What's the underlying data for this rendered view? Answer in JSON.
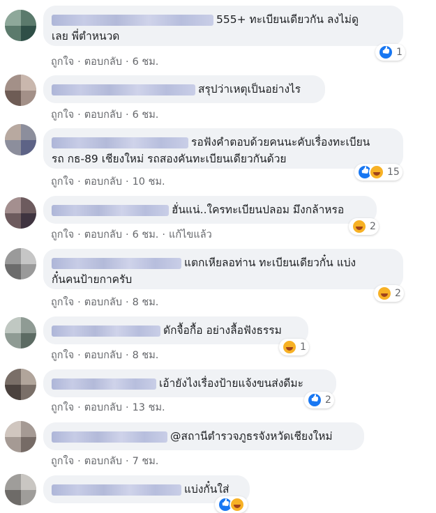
{
  "labels": {
    "like": "ถูกใจ",
    "reply": "ตอบกลับ",
    "dot": "·",
    "edited": "แก้ไขแล้ว"
  },
  "colors": {
    "bubble": "#f0f2f5",
    "meta": "#65676b",
    "like_blue": "#1877f2",
    "haha_yellow": "#f7b125"
  },
  "comments": [
    {
      "lines": [
        "555+ ทะเบียนเดียวกัน ลงไม่ดู",
        "เลย พี่ตำหนวด"
      ],
      "time": "6 ชม.",
      "reactions": [
        "like-icon"
      ],
      "count": "1"
    },
    {
      "lines": [
        "สรุปว่าเหตุเป็นอย่างไร"
      ],
      "time": "6 ชม.",
      "reactions": [],
      "count": ""
    },
    {
      "lines": [
        "รอฟังคำตอบด้วยคนนะคับเรื่องทะเบียน",
        "รถ กธ-89 เชียงใหม่ รถสองคันทะเบียนเดียวกันด้วย"
      ],
      "time": "10 ชม.",
      "reactions": [
        "like-icon",
        "haha-icon"
      ],
      "count": "15"
    },
    {
      "lines": [
        "ฮั่นแน่..ใครทะเบียนปลอม มึงกล้าหรอ"
      ],
      "time": "6 ชม.",
      "edited": true,
      "reactions": [
        "haha-icon"
      ],
      "count": "2"
    },
    {
      "lines": [
        "แตกเหียลอท่าน ทะเบียนเดียวกั๋น แบ่ง",
        "กั๋นคนป้ายกาครับ"
      ],
      "time": "8 ชม.",
      "reactions": [
        "haha-icon"
      ],
      "count": "2"
    },
    {
      "lines": [
        "ดักจื้อกื้อ อย่างลื้อฟังธรรม"
      ],
      "time": "8 ชม.",
      "reactions": [
        "haha-icon"
      ],
      "count": "1"
    },
    {
      "lines": [
        "เอ้ายังไงเรื่องป้ายแจ้งขนส่งดีมะ"
      ],
      "time": "13 ชม.",
      "reactions": [
        "like-icon"
      ],
      "count": "2"
    },
    {
      "lines": [
        "@สถานีตำรวจภูธรจังหวัดเชียงใหม่"
      ],
      "time": "7 ชม.",
      "reactions": [],
      "count": ""
    },
    {
      "lines": [
        "แบ่งกั๋นใส่"
      ],
      "time": "",
      "reactions": [
        "like-icon",
        "haha-icon"
      ],
      "count": ""
    }
  ]
}
